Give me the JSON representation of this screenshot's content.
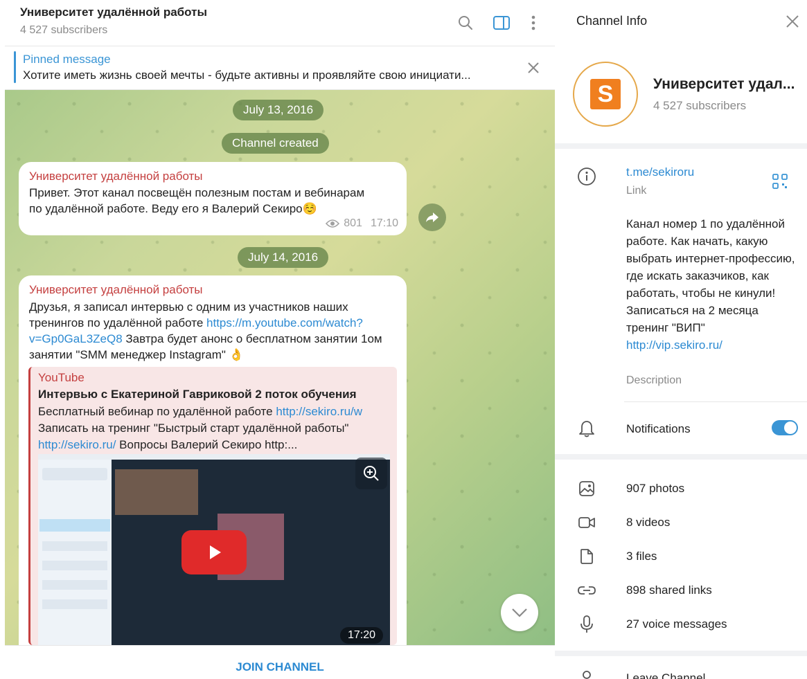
{
  "header": {
    "title": "Университет удалённой работы",
    "subscribers": "4 527 subscribers"
  },
  "pinned": {
    "label": "Pinned message",
    "text": "Хотите иметь жизнь своей мечты - будьте активны и проявляйте свою инициати..."
  },
  "feed": {
    "date1": "July 13, 2016",
    "service1": "Channel created",
    "msg1": {
      "sender": "Университет удалённой работы",
      "line1": "Привет. Этот канал посвещён полезным постам и вебинарам",
      "line2": "по удалённой работе. Веду его я Валерий Секиро☺️",
      "views": "801",
      "time": "17:10"
    },
    "date2": "July 14, 2016",
    "msg2": {
      "sender": "Университет удалённой работы",
      "line1": "Друзья, я записал интервью с одним из участников наших",
      "line2a": "тренингов по удалённой работе ",
      "link1": "https://m.youtube.com/watch?",
      "link2": "v=Gp0GaL3ZeQ8",
      "line3b": " Завтра будет анонс о бесплатном занятии 1ом",
      "line4": "занятии \"SMM менеджер Instagram\" 👌"
    },
    "preview": {
      "site": "YouTube",
      "title": "Интервью с Екатериной Гавриковой 2 поток обучения",
      "desc_a": "Бесплатный вебинар по удалённой работе ",
      "desc_link_a": "http://sekiro.ru/w",
      "desc_b": "Записать на тренинг \"Быстрый старт удалённой работы\"",
      "desc_link_b": "http://sekiro.ru/",
      "desc_c": " Вопросы Валерий Секиро http:...",
      "duration": "17:20"
    },
    "join": "JOIN CHANNEL"
  },
  "info": {
    "title": "Channel Info",
    "name": "Университет удал...",
    "subscribers": "4 527 subscribers",
    "link": "t.me/sekiroru",
    "link_label": "Link",
    "description": "Канал номер 1 по удалённой работе. Как начать, какую выбрать интернет-профессию, где искать заказчиков, как работать, чтобы не кинули! Записаться на 2 месяца тренинг \"ВИП\"",
    "desc_link": "http://vip.sekiro.ru/",
    "desc_label": "Description",
    "notifications": "Notifications",
    "notifications_on": true,
    "photos": "907 photos",
    "videos": "8 videos",
    "files": "3 files",
    "links": "898 shared links",
    "voice": "27 voice messages",
    "leave": "Leave Channel"
  },
  "colors": {
    "accent": "#3a95d5",
    "sender": "#c43f3f",
    "avatar_orange": "#f07f1f"
  }
}
